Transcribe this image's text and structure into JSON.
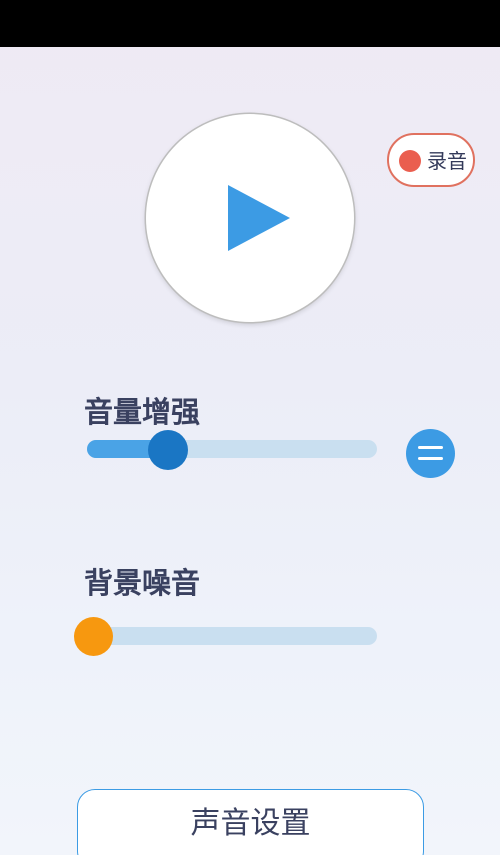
{
  "record": {
    "label": "录音"
  },
  "volume_boost": {
    "title": "音量增强",
    "level": 0.27
  },
  "background_noise": {
    "title": "背景噪音",
    "level": 0.0
  },
  "settings": {
    "label": "声音设置"
  },
  "icons": {
    "play": "play-icon",
    "record": "record-dot-icon",
    "menu": "menu-lines-icon"
  },
  "colors": {
    "accent": "#3c9be4",
    "track": "#c9dff0",
    "volume_thumb": "#1a76c4",
    "noise_thumb": "#f7980f",
    "record_dot": "#ea5e4f",
    "record_border": "#e0715f",
    "text": "#3a4160"
  }
}
